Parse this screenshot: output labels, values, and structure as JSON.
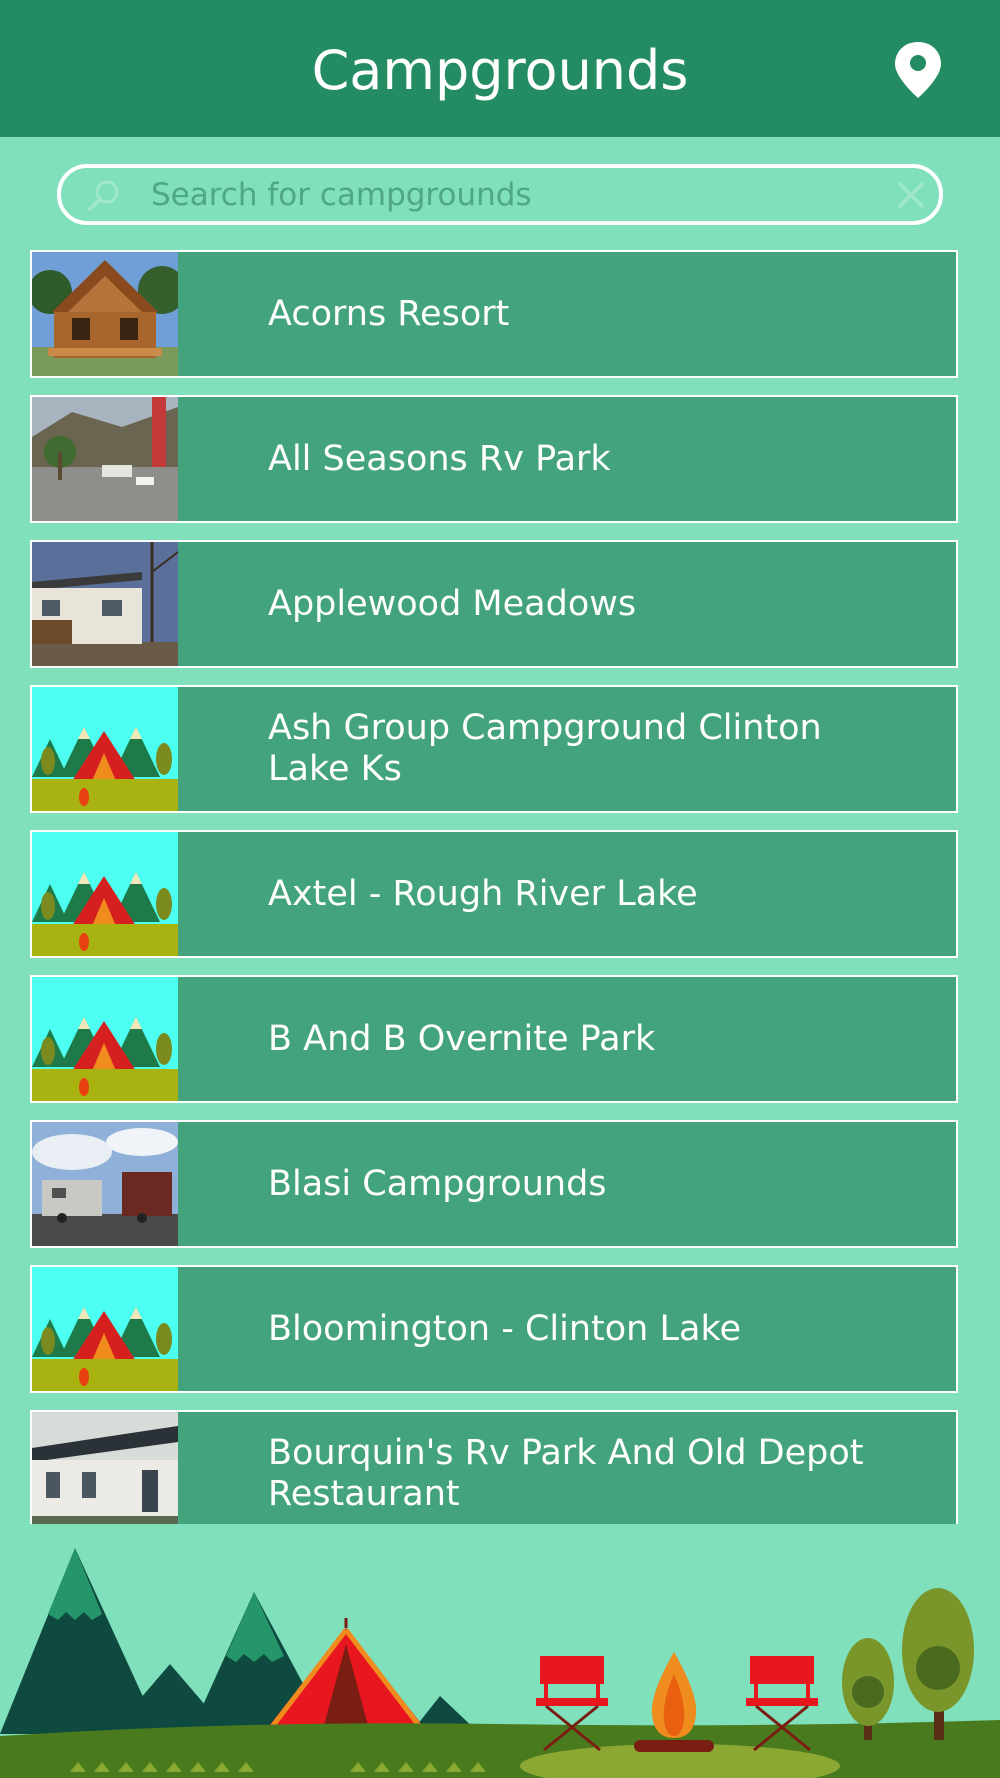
{
  "header": {
    "title": "Campgrounds",
    "location_button": "location-pin-icon"
  },
  "search": {
    "placeholder": "Search for campgrounds",
    "value": "",
    "search_icon": "magnifier-icon",
    "clear_icon": "close-icon"
  },
  "campgrounds": [
    {
      "name": "Acorns Resort",
      "thumbnail": "log-cabin-photo"
    },
    {
      "name": "All Seasons Rv Park",
      "thumbnail": "rv-park-hillside-photo"
    },
    {
      "name": "Applewood Meadows",
      "thumbnail": "mobile-home-photo"
    },
    {
      "name": "Ash Group Campground Clinton Lake Ks",
      "thumbnail": "tent-placeholder-illustration"
    },
    {
      "name": "Axtel - Rough River Lake",
      "thumbnail": "tent-placeholder-illustration"
    },
    {
      "name": "B And B Overnite Park",
      "thumbnail": "tent-placeholder-illustration"
    },
    {
      "name": "Blasi Campgrounds",
      "thumbnail": "rv-lot-photo"
    },
    {
      "name": "Bloomington - Clinton Lake",
      "thumbnail": "tent-placeholder-illustration"
    },
    {
      "name": "Bourquin's Rv Park And Old Depot Restaurant",
      "thumbnail": "depot-building-photo"
    }
  ],
  "colors": {
    "header": "#238c62",
    "background": "#7fe0bb",
    "row": "#43a37d",
    "row_border": "#ffffff"
  }
}
